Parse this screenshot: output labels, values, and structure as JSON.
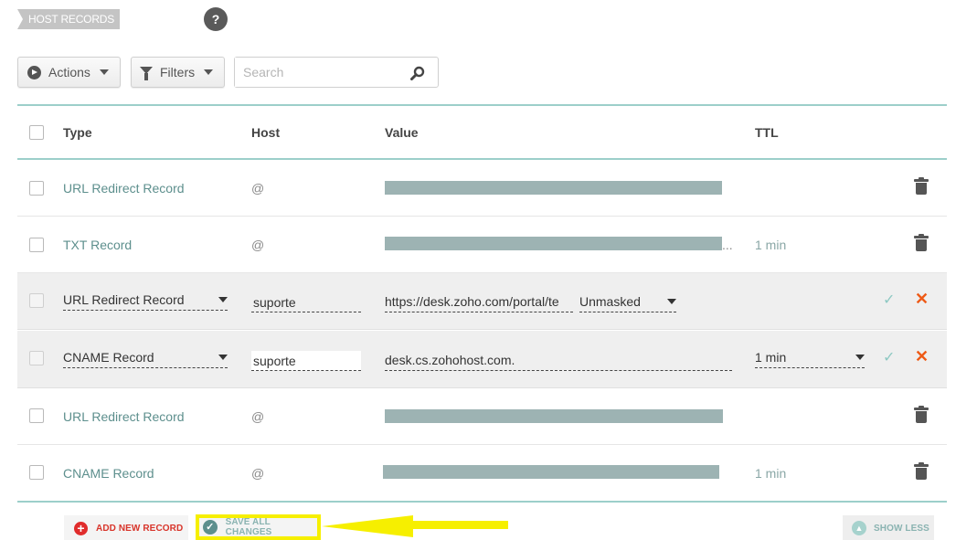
{
  "header": {
    "section_label": "HOST RECORDS",
    "help_label": "?"
  },
  "toolbar": {
    "actions_label": "Actions",
    "filters_label": "Filters",
    "search_placeholder": "Search"
  },
  "table": {
    "columns": {
      "type": "Type",
      "host": "Host",
      "value": "Value",
      "ttl": "TTL"
    },
    "rows": [
      {
        "type": "URL Redirect Record",
        "host": "@",
        "value": "",
        "ttl": ""
      },
      {
        "type": "TXT Record",
        "host": "@",
        "value": "",
        "value_suffix": "...",
        "ttl": "1 min"
      },
      {
        "type": "URL Redirect Record",
        "host": "suporte",
        "value": "https://desk.zoho.com/portal/te",
        "redirect_mode": "Unmasked",
        "ttl": ""
      },
      {
        "type": "CNAME Record",
        "host": "suporte",
        "value": "desk.cs.zohohost.com.",
        "ttl": "1 min"
      },
      {
        "type": "URL Redirect Record",
        "host": "@",
        "value": "",
        "ttl": ""
      },
      {
        "type": "CNAME Record",
        "host": "@",
        "value": "",
        "ttl": "1 min"
      }
    ],
    "check_symbol": "✓",
    "cancel_symbol": "✕"
  },
  "footer": {
    "add_label": "ADD NEW RECORD",
    "save_label": "SAVE ALL CHANGES",
    "show_less_label": "SHOW LESS"
  },
  "icons": {
    "actions": "play-circle-icon",
    "filters": "funnel-icon",
    "search": "magnifier-icon",
    "delete": "trash-icon",
    "confirm": "check-icon",
    "cancel": "close-icon",
    "add": "plus-circle-icon",
    "save": "check-circle-icon",
    "show_less": "chevron-up-icon",
    "annotation": "arrow-left-icon"
  },
  "colors": {
    "accent": "#5d8f8d",
    "divider": "#9ccfca",
    "danger": "#e02c2c",
    "cancel": "#ee5a16",
    "highlight": "#f6ef00",
    "redaction": "#9db3b3"
  }
}
